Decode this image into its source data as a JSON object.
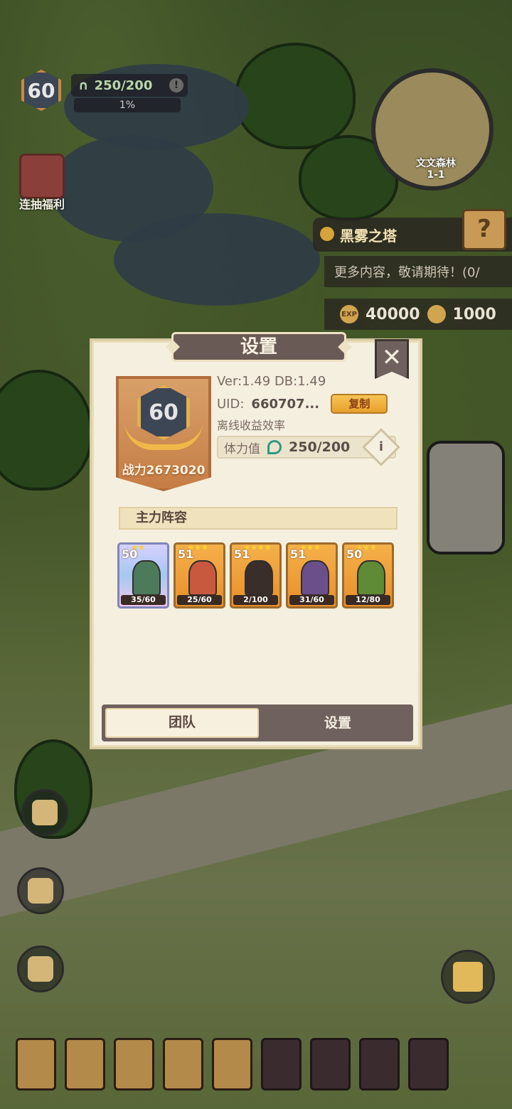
{
  "hud": {
    "player_level": "60",
    "stamina": "250/200",
    "progress_pct": "1%",
    "gift_label": "连抽福利",
    "map_location": "文文森林",
    "map_stage": "1-1"
  },
  "quest": {
    "title": "黑雾之塔",
    "subtitle": "更多内容，敬请期待！(0/",
    "reward_exp": "40000",
    "reward_gold": "1000"
  },
  "dialog": {
    "title": "设置",
    "level": "60",
    "power_label": "战力2673020",
    "version": "Ver:1.49  DB:1.49",
    "uid_label": "UID:",
    "uid_value": "660707...",
    "copy_button": "复制",
    "offline_label": "离线收益效率",
    "stamina_label": "体力值",
    "stamina_value": "250/200",
    "info_button": "i",
    "section_title": "主力阵容",
    "heroes": [
      {
        "level": "50",
        "progress": "35/60",
        "stars": "★★"
      },
      {
        "level": "51",
        "progress": "25/60",
        "stars": "★★★"
      },
      {
        "level": "51",
        "progress": "2/100",
        "stars": "★★★★"
      },
      {
        "level": "51",
        "progress": "31/60",
        "stars": "★★★"
      },
      {
        "level": "50",
        "progress": "12/80",
        "stars": "★★★"
      }
    ],
    "tabs": {
      "team": "团队",
      "settings": "设置"
    }
  },
  "colors": {
    "panel_bg": "#f5efdf",
    "title_bar": "#6a5a55",
    "accent_gold": "#f0b849"
  }
}
